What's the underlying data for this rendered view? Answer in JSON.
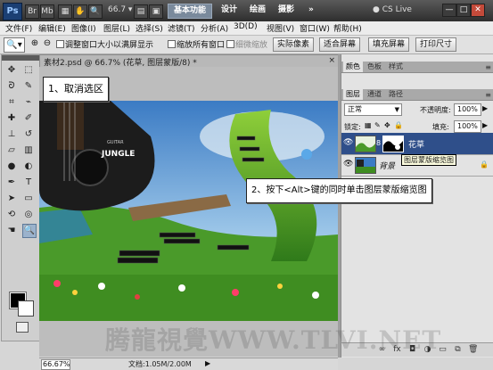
{
  "app": {
    "logo": "Ps",
    "zoom": "66.7",
    "workspaces": [
      "基本功能",
      "设计",
      "绘画",
      "摄影"
    ],
    "more": "»",
    "cs_live": "CS Live",
    "window_buttons": [
      "—",
      "□",
      "✕"
    ]
  },
  "menu": [
    "文件(F)",
    "编辑(E)",
    "图像(I)",
    "图层(L)",
    "选择(S)",
    "滤镜(T)",
    "分析(A)",
    "3D(D)",
    "视图(V)",
    "窗口(W)",
    "帮助(H)"
  ],
  "options": {
    "resize_windows": "调整窗口大小以满屏显示",
    "zoom_all": "缩放所有窗口",
    "scrubby_zoom": "细微缩放",
    "actual_pixels": "实际像素",
    "fit_screen": "适合屏幕",
    "fill_screen": "填充屏幕",
    "print_size": "打印尺寸"
  },
  "document": {
    "tab": "素材2.psd @ 66.7% (花草, 图层蒙版/8) *",
    "close": "×",
    "zoom_value": "66.67%",
    "doc_size": "文档:1.05M/2.00M",
    "artwork": {
      "logo_text": "JUNGLE",
      "logo_small": "GUITAR"
    }
  },
  "panels": {
    "top_tabs": [
      "颜色",
      "色板",
      "样式"
    ],
    "layer_tabs": [
      "图层",
      "通道",
      "路径"
    ],
    "blend_mode": "正常",
    "opacity_label": "不透明度:",
    "opacity_value": "100%",
    "lock_label": "锁定:",
    "fill_label": "填充:",
    "fill_value": "100%",
    "layers": [
      {
        "name": "花草",
        "active": true
      },
      {
        "name": "背景",
        "active": false
      }
    ],
    "tooltip": "图层蒙版缩览图",
    "bottom_icons": [
      "link-icon",
      "fx-icon",
      "mask-icon",
      "adjust-icon",
      "folder-icon",
      "new-layer-icon",
      "trash-icon"
    ]
  },
  "callouts": {
    "step1": "1、取消选区",
    "step2": "2、按下<Alt>键的同时单击图层蒙版缩览图"
  },
  "watermark": "腾龍視覺WWW.TLVI.NET",
  "colors": {
    "app_bar": "#3a3a3a",
    "active_layer": "#2f4f8a",
    "foreground": "#000000",
    "background": "#ffffff"
  }
}
